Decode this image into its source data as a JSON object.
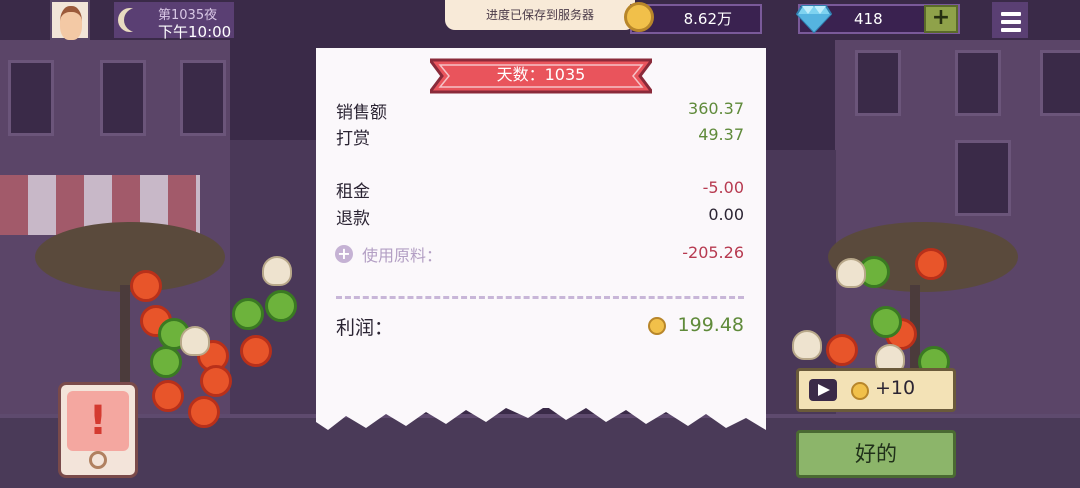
{
  "top_bar": {
    "day_label": "第1035夜",
    "time_label": "下午10:00",
    "save_toast": "进度已保存到服务器",
    "money": "8.62万",
    "gems": "418",
    "add_gems_label": "+"
  },
  "receipt": {
    "ribbon_title": "天数：1035",
    "rows": [
      {
        "label": "销售额",
        "value": "360.37"
      },
      {
        "label": "打赏",
        "value": "49.37"
      },
      {
        "label": "租金",
        "value": "-5.00"
      },
      {
        "label": "退款",
        "value": "0.00"
      }
    ],
    "ingredients_label": "使用原料：",
    "ingredients_value": "-205.26",
    "profit_label": "利润：",
    "profit_value": "199.48"
  },
  "actions": {
    "ad_reward_label": "+10",
    "ok_label": "好的"
  },
  "colors": {
    "positive": "#5f8a3a",
    "negative": "#b73a50",
    "ribbon": "#e9545c",
    "panel_purple": "#5a3f73"
  }
}
